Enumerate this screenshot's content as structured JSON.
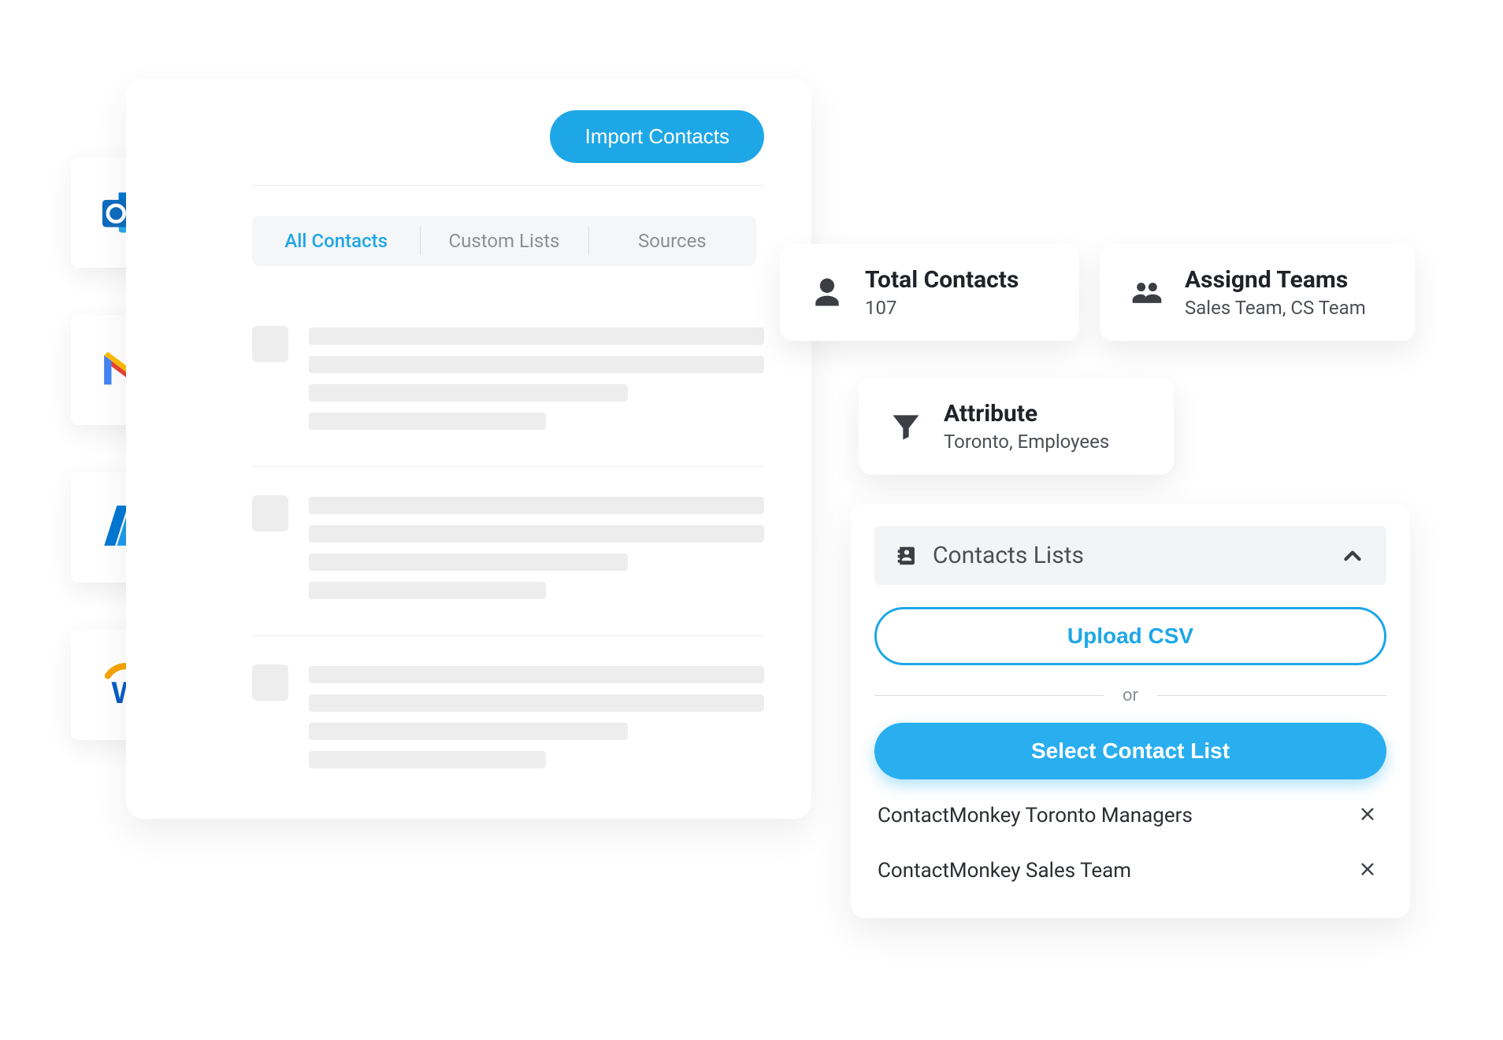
{
  "integrations": [
    {
      "name": "outlook"
    },
    {
      "name": "gmail"
    },
    {
      "name": "azure"
    },
    {
      "name": "workday"
    }
  ],
  "contacts_panel": {
    "import_button": "Import Contacts",
    "tabs": {
      "all": "All Contacts",
      "custom": "Custom Lists",
      "sources": "Sources"
    }
  },
  "stats": {
    "total_contacts": {
      "label": "Total Contacts",
      "value": "107"
    },
    "assigned_teams": {
      "label": "Assignd Teams",
      "value": "Sales Team, CS Team"
    },
    "attribute": {
      "label": "Attribute",
      "value": "Toronto, Employees"
    }
  },
  "lists_panel": {
    "header": "Contacts Lists",
    "upload_csv": "Upload CSV",
    "or_label": "or",
    "select_list": "Select Contact List",
    "items": [
      "ContactMonkey Toronto Managers",
      "ContactMonkey Sales Team"
    ]
  }
}
